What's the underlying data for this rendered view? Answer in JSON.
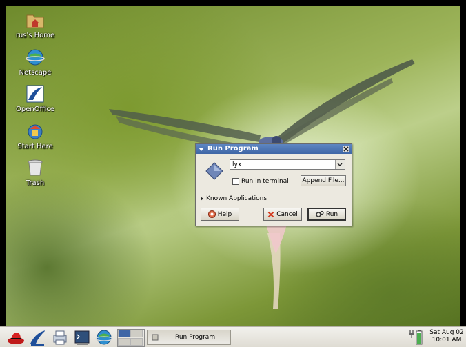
{
  "desktop": {
    "icons": [
      {
        "label": "rus's Home",
        "icon": "home-folder-icon"
      },
      {
        "label": "Netscape",
        "icon": "netscape-icon"
      },
      {
        "label": "OpenOffice",
        "icon": "openoffice-icon"
      },
      {
        "label": "Start Here",
        "icon": "start-here-icon"
      },
      {
        "label": "Trash",
        "icon": "trash-icon"
      }
    ]
  },
  "dialog": {
    "title": "Run Program",
    "command_value": "lyx",
    "run_in_terminal_label": "Run in terminal",
    "run_in_terminal_checked": false,
    "append_file_label": "Append File...",
    "known_applications_label": "Known Applications",
    "help_label": "Help",
    "cancel_label": "Cancel",
    "run_label": "Run"
  },
  "taskbar": {
    "launchers": [
      "redhat-menu-icon",
      "openoffice-writer-icon",
      "printer-icon",
      "terminal-icon",
      "browser-icon"
    ],
    "task_label": "Run Program",
    "clock_date": "Sat Aug 02",
    "clock_time": "10:01 AM"
  },
  "colors": {
    "titlebar": "#3f66a6",
    "dialog_bg": "#ece9e0",
    "taskbar_bg": "#e8e6df"
  }
}
